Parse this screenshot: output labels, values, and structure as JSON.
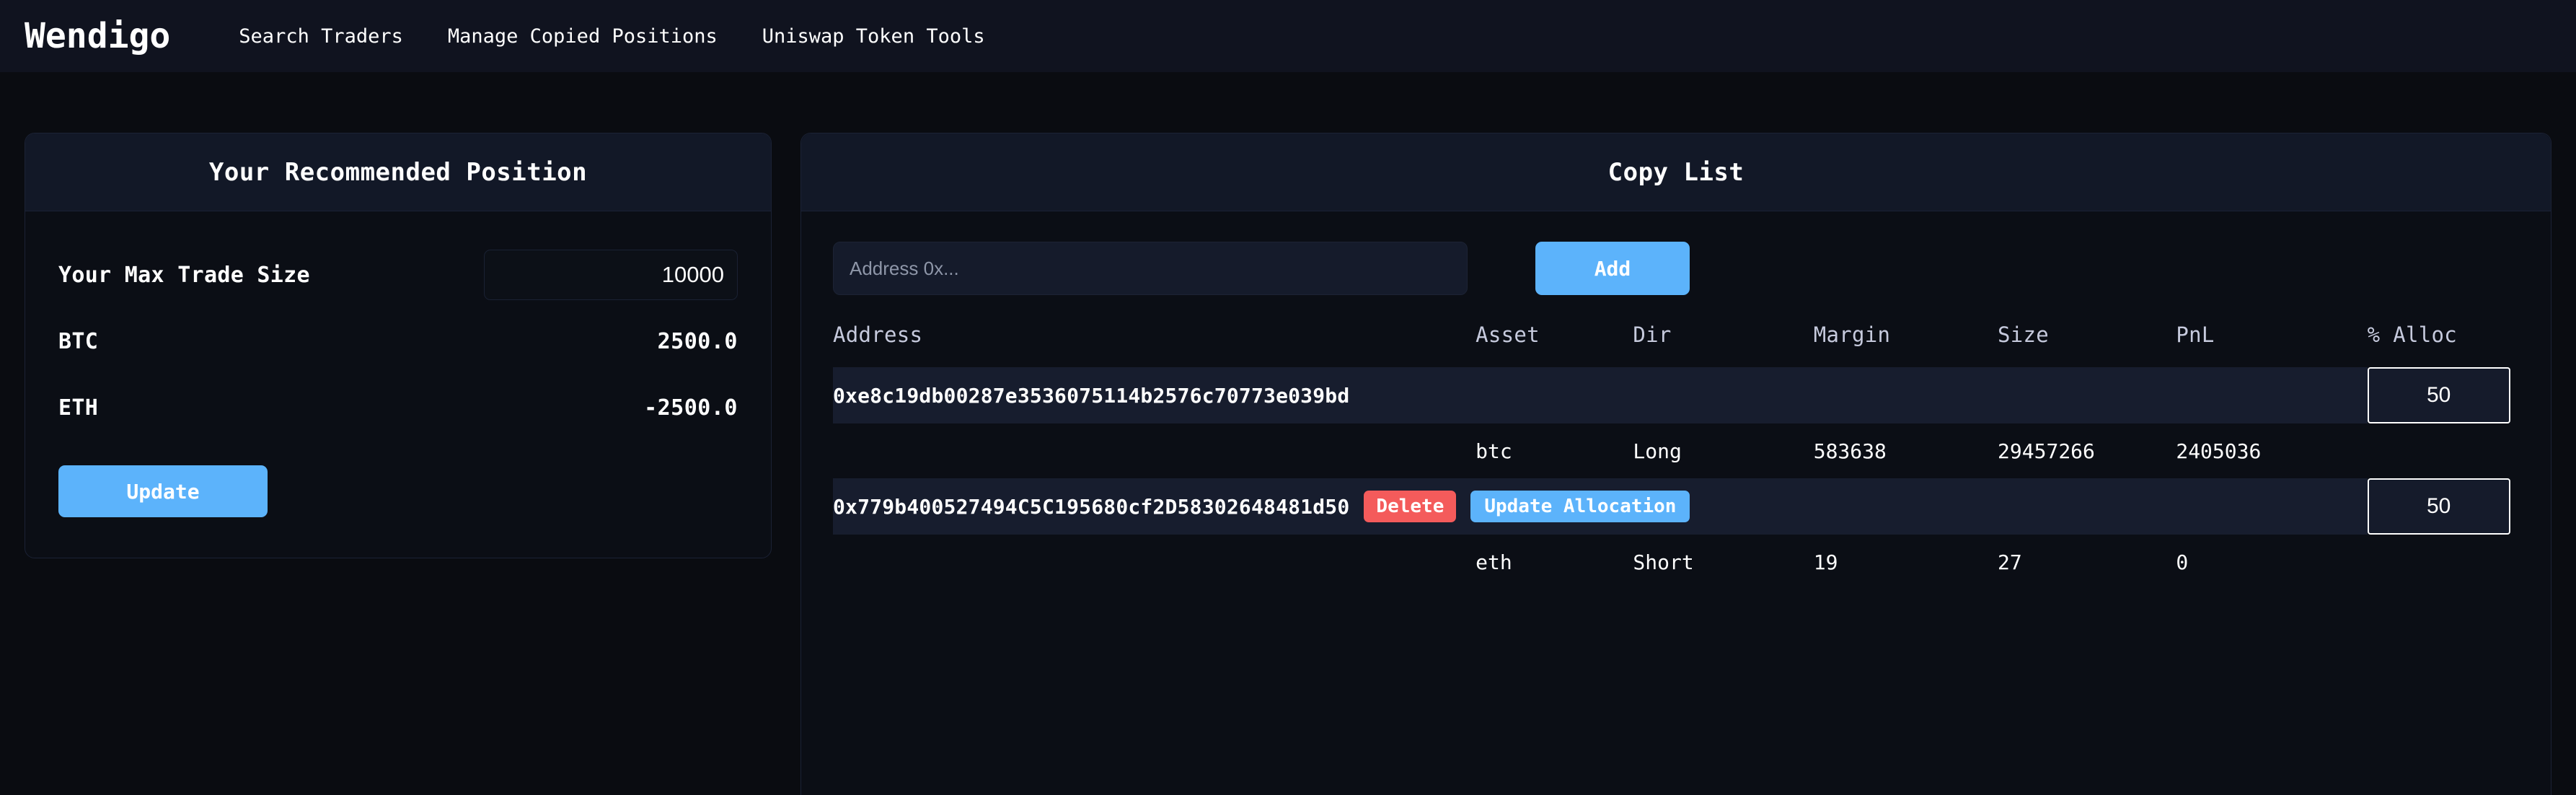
{
  "navbar": {
    "brand": "Wendigo",
    "links": [
      {
        "label": "Search Traders"
      },
      {
        "label": "Manage Copied Positions"
      },
      {
        "label": "Uniswap Token Tools"
      }
    ]
  },
  "recommended_panel": {
    "title": "Your Recommended Position",
    "max_trade_size_label": "Your Max Trade Size",
    "max_trade_size_value": "10000",
    "max_trade_size_placeholder": "",
    "rows": [
      {
        "label": "BTC",
        "value": "2500.0"
      },
      {
        "label": "ETH",
        "value": "-2500.0"
      }
    ],
    "update_button": "Update"
  },
  "copy_list_panel": {
    "title": "Copy List",
    "address_input_value": "",
    "address_input_placeholder": "Address 0x...",
    "add_button": "Add",
    "table": {
      "headers": {
        "address": "Address",
        "asset": "Asset",
        "dir": "Dir",
        "margin": "Margin",
        "size": "Size",
        "pnl": "PnL",
        "alloc": "% Alloc"
      },
      "entries": [
        {
          "address": "0xe8c19db00287e3536075114b2576c70773e039bd",
          "show_buttons": false,
          "delete_label": "Delete",
          "update_alloc_label": "Update Allocation",
          "alloc_value": "50",
          "positions": [
            {
              "asset": "btc",
              "dir": "Long",
              "margin": "583638",
              "size": "29457266",
              "pnl": "2405036",
              "pnl_sign": "positive"
            }
          ]
        },
        {
          "address": "0x779b400527494C5C195680cf2D58302648481d50",
          "show_buttons": true,
          "delete_label": "Delete",
          "update_alloc_label": "Update Allocation",
          "alloc_value": "50",
          "positions": [
            {
              "asset": "eth",
              "dir": "Short",
              "margin": "19",
              "size": "27",
              "pnl": "0",
              "pnl_sign": "zero"
            }
          ]
        }
      ]
    }
  },
  "colors": {
    "page_bg": "#0a0c11",
    "navbar_bg": "#10131f",
    "card_header_bg": "#121827",
    "accent_blue": "#5cb3fb",
    "danger_red": "#f45b5b",
    "pnl_green": "#4ade80",
    "row_highlight": "#171d2e",
    "header_text": "#c6cadd"
  }
}
